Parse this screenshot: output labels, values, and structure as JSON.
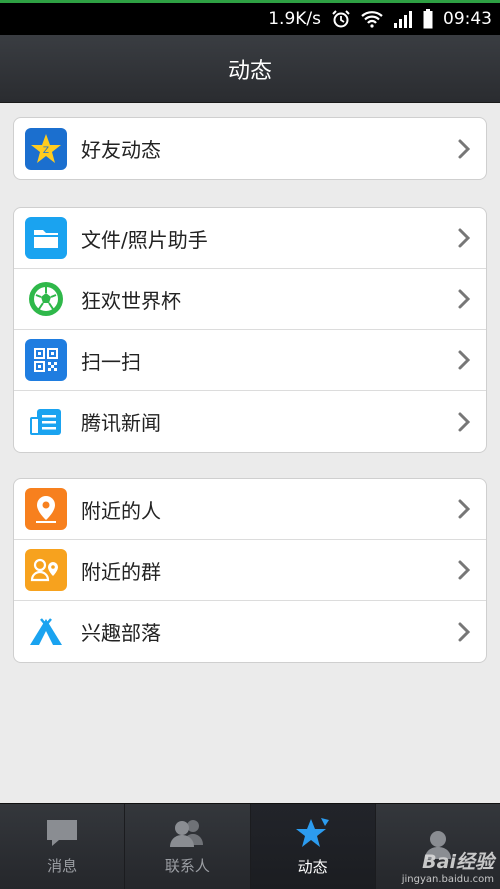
{
  "status_bar": {
    "net_speed": "1.9K/s",
    "time": "09:43",
    "icons": [
      "alarm-icon",
      "wifi-icon",
      "signal-icon",
      "battery-icon"
    ]
  },
  "header": {
    "title": "动态"
  },
  "groups": [
    {
      "items": [
        {
          "label": "好友动态",
          "icon": "qzone-star-icon"
        }
      ]
    },
    {
      "items": [
        {
          "label": "文件/照片助手",
          "icon": "folder-icon"
        },
        {
          "label": "狂欢世界杯",
          "icon": "soccer-ball-icon"
        },
        {
          "label": "扫一扫",
          "icon": "qr-code-icon"
        },
        {
          "label": "腾讯新闻",
          "icon": "news-icon"
        }
      ]
    },
    {
      "items": [
        {
          "label": "附近的人",
          "icon": "location-pin-icon"
        },
        {
          "label": "附近的群",
          "icon": "nearby-group-icon"
        },
        {
          "label": "兴趣部落",
          "icon": "tent-icon"
        }
      ]
    }
  ],
  "tabs": [
    {
      "label": "消息",
      "icon": "chat-bubble-icon"
    },
    {
      "label": "联系人",
      "icon": "contacts-icon"
    },
    {
      "label": "动态",
      "icon": "star-icon",
      "active": true
    },
    {
      "label": "",
      "icon": "profile-icon"
    }
  ],
  "watermark": {
    "brand": "Bai经验",
    "url": "jingyan.baidu.com"
  },
  "colors": {
    "header_bg": "#2f3236",
    "tabbar_bg": "#2c2e32",
    "page_bg": "#ebebeb",
    "folder_blue": "#1aa3f0",
    "qr_blue": "#1f7de0",
    "orange": "#f79a1e",
    "soccer_green": "#2fb84a",
    "tent_blue": "#1aa3f0"
  }
}
